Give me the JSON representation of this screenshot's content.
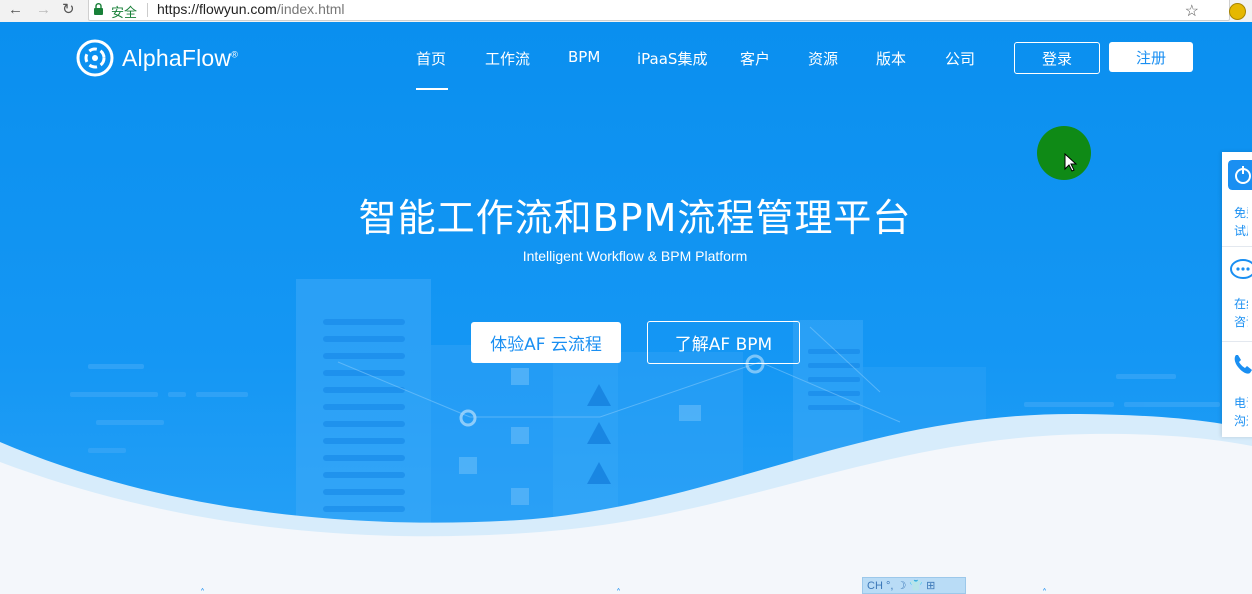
{
  "browser": {
    "security_label": "安全",
    "url_host": "https://flowyun.com",
    "url_path": "/index.html"
  },
  "header": {
    "logo_text": "AlphaFlow",
    "logo_mark": "®",
    "nav": [
      {
        "label": "首页",
        "active": true
      },
      {
        "label": "工作流"
      },
      {
        "label": "BPM"
      },
      {
        "label": "iPaaS集成"
      },
      {
        "label": "客户"
      },
      {
        "label": "资源"
      },
      {
        "label": "版本"
      },
      {
        "label": "公司"
      }
    ],
    "login_label": "登录",
    "register_label": "注册"
  },
  "hero": {
    "title": "智能工作流和BPM流程管理平台",
    "subtitle": "Intelligent Workflow & BPM Platform",
    "cta_primary": "体验AF 云流程",
    "cta_secondary": "了解AF BPM"
  },
  "side_panel": {
    "items": [
      {
        "icon": "power-icon",
        "label_lines": [
          "免费",
          "试用"
        ]
      },
      {
        "icon": "chat-icon",
        "label_lines": [
          "在线",
          "咨询"
        ]
      },
      {
        "icon": "phone-icon",
        "label_lines": [
          "电话",
          "沟通"
        ]
      }
    ]
  },
  "ime_bar": {
    "label": "CH °, ☽ 👕 ⊞"
  },
  "colors": {
    "hero_blue": "#1597f4",
    "accent": "#1a8ff2",
    "cursor_highlight": "#0f8a16"
  }
}
